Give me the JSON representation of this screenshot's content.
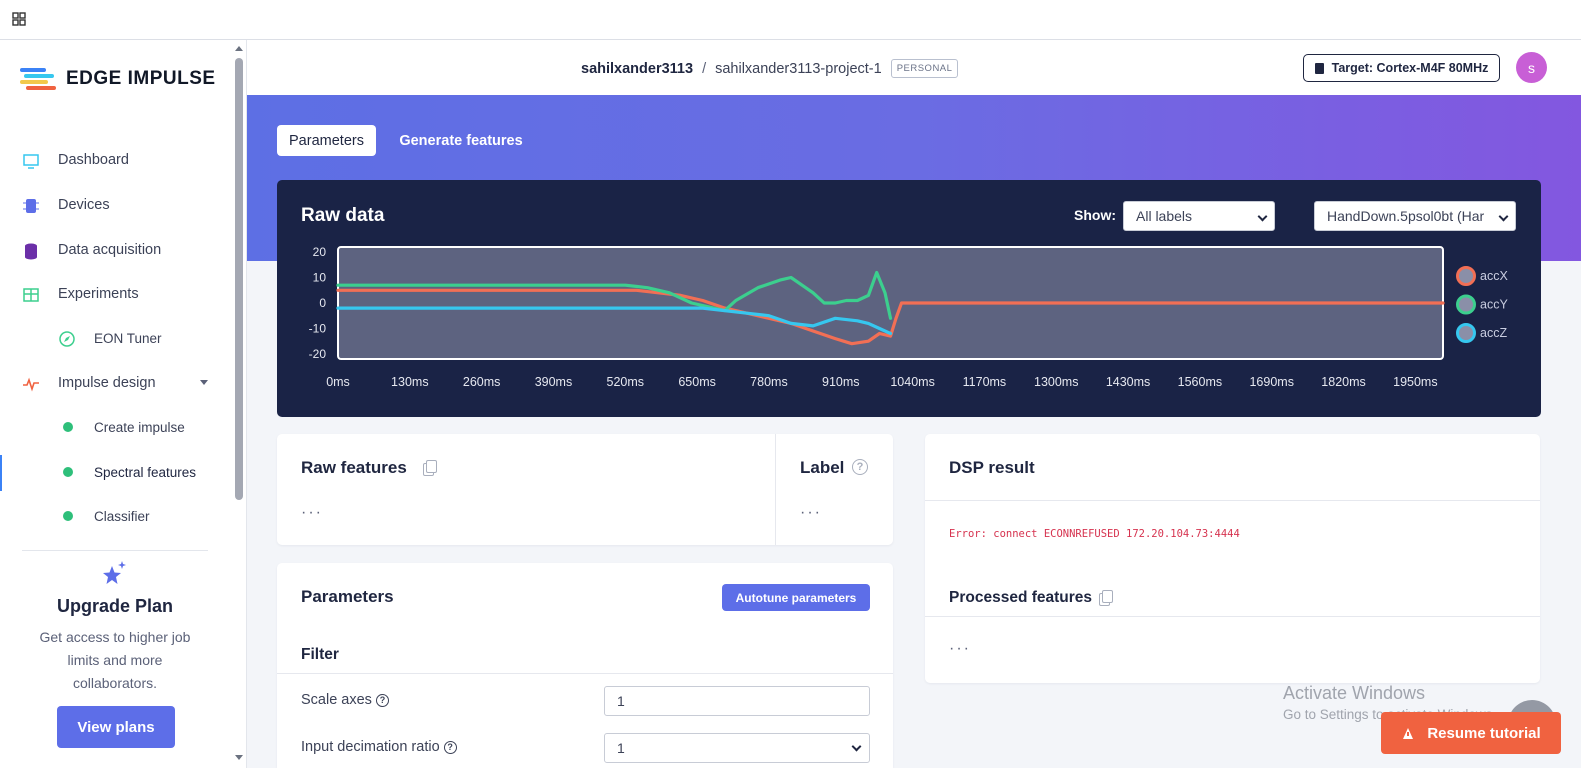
{
  "topbar": {
    "apps_icon": "grid-icon"
  },
  "sidebar": {
    "brand": "EDGE IMPULSE",
    "items": [
      {
        "label": "Dashboard",
        "icon": "monitor-icon"
      },
      {
        "label": "Devices",
        "icon": "chip-icon"
      },
      {
        "label": "Data acquisition",
        "icon": "database-icon"
      },
      {
        "label": "Experiments",
        "icon": "table-icon"
      },
      {
        "label": "EON Tuner",
        "icon": "compass-icon"
      },
      {
        "label": "Impulse design",
        "icon": "pulse-icon"
      },
      {
        "label": "Create impulse",
        "icon": "dot-icon"
      },
      {
        "label": "Spectral features",
        "icon": "dot-icon"
      },
      {
        "label": "Classifier",
        "icon": "dot-icon"
      }
    ],
    "upgrade": {
      "title": "Upgrade Plan",
      "desc_line1": "Get access to higher job",
      "desc_line2": "limits and more",
      "desc_line3": "collaborators.",
      "button": "View plans"
    }
  },
  "header": {
    "user": "sahilxander3113",
    "separator": "/",
    "project": "sahilxander3113-project-1",
    "badge": "PERSONAL",
    "target": "Target: Cortex-M4F 80MHz",
    "avatar_letter": "s"
  },
  "tabs": {
    "parameters": "Parameters",
    "generate": "Generate features"
  },
  "raw_data": {
    "title": "Raw data",
    "show_label": "Show:",
    "show_value": "All labels",
    "sample_value": "HandDown.5psol0bt (Har"
  },
  "chart_data": {
    "type": "line",
    "xlabel": "",
    "ylabel": "",
    "x_ticks": [
      "0ms",
      "130ms",
      "260ms",
      "390ms",
      "520ms",
      "650ms",
      "780ms",
      "910ms",
      "1040ms",
      "1170ms",
      "1300ms",
      "1430ms",
      "1560ms",
      "1690ms",
      "1820ms",
      "1950ms"
    ],
    "y_ticks": [
      20,
      10,
      0,
      -10,
      -20
    ],
    "xlim": [
      0,
      2000
    ],
    "ylim": [
      -22,
      22
    ],
    "legend_position": "right",
    "series": [
      {
        "name": "accX",
        "color": "#f26f55",
        "x": [
          0,
          100,
          200,
          300,
          400,
          500,
          540,
          580,
          620,
          660,
          700,
          740,
          780,
          820,
          860,
          900,
          930,
          960,
          980,
          1000,
          1010,
          1020,
          1100,
          1300,
          1500,
          1700,
          1900,
          2000
        ],
        "y": [
          5,
          5,
          5,
          5,
          5,
          5,
          5,
          4,
          3,
          1,
          -2,
          -4,
          -6,
          -8,
          -11,
          -14,
          -16,
          -15,
          -12,
          -13,
          -6,
          0,
          0,
          0,
          0,
          0,
          0,
          0
        ]
      },
      {
        "name": "accY",
        "color": "#3ccf8e",
        "x": [
          0,
          100,
          200,
          300,
          400,
          480,
          520,
          560,
          600,
          640,
          680,
          700,
          720,
          760,
          800,
          820,
          840,
          860,
          880,
          900,
          920,
          940,
          960,
          975,
          990,
          1000
        ],
        "y": [
          7,
          7,
          7,
          7,
          7,
          7,
          7,
          6,
          4,
          0,
          -2,
          -3,
          1,
          6,
          9,
          10,
          7,
          4,
          0,
          0,
          1,
          1,
          3,
          12,
          4,
          -6
        ]
      },
      {
        "name": "accZ",
        "color": "#36c7ef",
        "x": [
          0,
          100,
          200,
          300,
          400,
          500,
          540,
          580,
          620,
          660,
          700,
          740,
          780,
          820,
          860,
          900,
          940,
          960,
          980,
          1000
        ],
        "y": [
          -2,
          -2,
          -2,
          -2,
          -2,
          -2,
          -2,
          -2,
          -2,
          -2,
          -3,
          -4,
          -5,
          -8,
          -9,
          -6,
          -7,
          -8,
          -10,
          -12
        ]
      }
    ]
  },
  "raw_features": {
    "title": "Raw features",
    "value": "···"
  },
  "label_card": {
    "title": "Label",
    "value": "···"
  },
  "dsp": {
    "title": "DSP result",
    "error": "Error: connect ECONNREFUSED 172.20.104.73:4444",
    "processed_title": "Processed features",
    "processed_value": "···"
  },
  "parameters": {
    "title": "Parameters",
    "autotune": "Autotune parameters",
    "filter_heading": "Filter",
    "scale_label": "Scale axes",
    "scale_value": "1",
    "decimation_label": "Input decimation ratio",
    "decimation_value": "1"
  },
  "watermark": {
    "line1": "Activate Windows",
    "line2": "Go to Settings to activate Windows."
  },
  "tutorial": {
    "label": "Resume tutorial"
  }
}
